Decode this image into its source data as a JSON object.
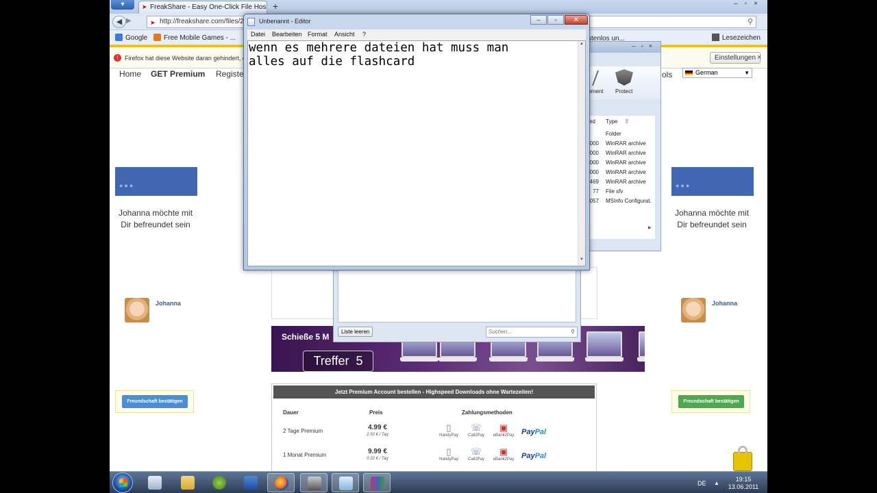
{
  "browser": {
    "tab_title": "FreakShare - Easy One-Click File Hosting",
    "new_tab": "+",
    "url": "http://freakshare.com/files/2",
    "bookmarks": [
      {
        "label": "Google",
        "color": "#3b7be0"
      },
      {
        "label": "Free Mobile Games - ...",
        "color": "#e07b20"
      }
    ],
    "bookmark_partial": "stenlos un...",
    "bookmarks_menu": "Lesezeichen",
    "notification": "Firefox hat diese Website daran gehindert, e",
    "notification_settings": "Einstellungen",
    "notification_close": "×"
  },
  "site": {
    "nav": [
      "Home",
      "GET Premium",
      "Registe"
    ],
    "tools_partial": "ols",
    "language": "German",
    "fb_left": {
      "text": "Johanna möchte mit Dir befreundet sein",
      "name": "Johanna",
      "button": "Freundschaft bestätigen",
      "button_color": "#4a8fd4"
    },
    "fb_right": {
      "text": "Johanna möchte mit Dir befreundet sein",
      "name": "Johanna",
      "button": "Freundschaft bestätigen",
      "button_color": "#4fa74f"
    },
    "banner_title": "Schieße 5 M",
    "banner_counter": "Treffer",
    "banner_count": "5",
    "premium": {
      "header": "Jetzt Premium Account bestellen - Highspeed Downloads ohne Wartezeiten!",
      "col_duration": "Dauer",
      "col_price": "Preis",
      "col_payment": "Zahlungsmethoden",
      "rows": [
        {
          "duration": "2 Tage Premium",
          "price": "4.99 €",
          "per_day": "2.50 € / Tag"
        },
        {
          "duration": "1 Monat Premium",
          "price": "9.99 €",
          "per_day": "0.32 € / Tag"
        }
      ],
      "payments": [
        "HandyPay",
        "Call2Pay",
        "eBank2Pay"
      ],
      "paypal_a": "Pay",
      "paypal_b": "Pal"
    }
  },
  "notepad": {
    "title": "Unbenannt - Editor",
    "menu": [
      "Datei",
      "Bearbeiten",
      "Format",
      "Ansicht",
      "?"
    ],
    "content": "wenn es mehrere dateien hat muss man\nalles auf die flashcard"
  },
  "archive_window": {
    "toolbar": [
      "mment",
      "Protect"
    ],
    "col_type": "Type",
    "rows": [
      {
        "num": "",
        "type": "Folder"
      },
      {
        "num": "000",
        "type": "WinRAR archive"
      },
      {
        "num": "000",
        "type": "WinRAR archive"
      },
      {
        "num": "000",
        "type": "WinRAR archive"
      },
      {
        "num": "000",
        "type": "WinRAR archive"
      },
      {
        "num": "469",
        "type": "WinRAR archive"
      },
      {
        "num": "77",
        "type": "File sfv"
      },
      {
        "num": "057",
        "type": "MSInfo Configurat."
      }
    ],
    "col_partial": "ced"
  },
  "downloader": {
    "clear_button": "Liste leeren",
    "search_placeholder": "Suchen..."
  },
  "taskbar": {
    "lang": "DE",
    "time": "19:15",
    "date": "13.06.2011"
  }
}
